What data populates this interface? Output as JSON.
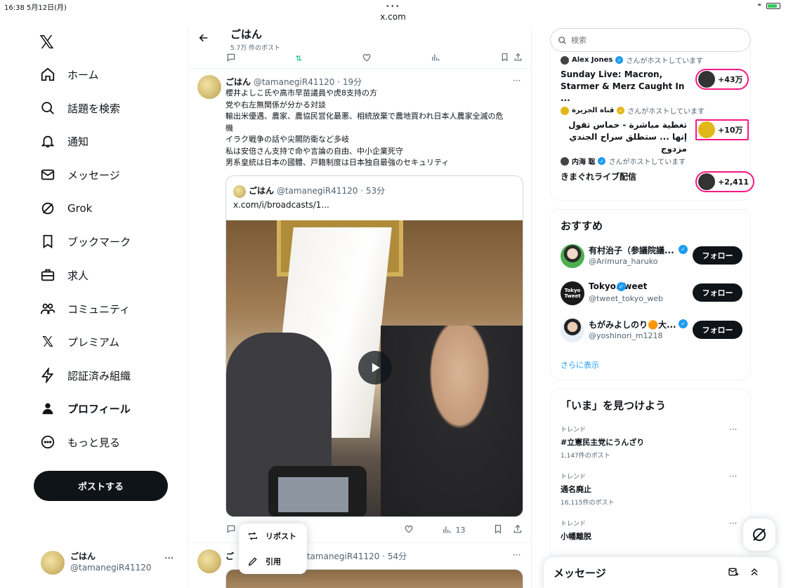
{
  "status_bar": {
    "time": "16:38",
    "date": "5月12日(月)",
    "url": "x.com",
    "dots": "•••"
  },
  "nav": {
    "items": [
      {
        "label": "ホーム",
        "icon": "home-icon"
      },
      {
        "label": "話題を検索",
        "icon": "search-icon"
      },
      {
        "label": "通知",
        "icon": "bell-icon"
      },
      {
        "label": "メッセージ",
        "icon": "mail-icon"
      },
      {
        "label": "Grok",
        "icon": "grok-icon"
      },
      {
        "label": "ブックマーク",
        "icon": "bookmark-icon"
      },
      {
        "label": "求人",
        "icon": "briefcase-icon"
      },
      {
        "label": "コミュニティ",
        "icon": "community-icon"
      },
      {
        "label": "プレミアム",
        "icon": "x-premium-icon"
      },
      {
        "label": "認証済み組織",
        "icon": "lightning-icon"
      },
      {
        "label": "プロフィール",
        "icon": "profile-icon"
      },
      {
        "label": "もっと見る",
        "icon": "more-circle-icon"
      }
    ],
    "post_button": "ポストする",
    "user": {
      "name": "ごはん",
      "handle": "@tamanegiR41120",
      "more": "···"
    }
  },
  "header": {
    "title": "ごはん",
    "subtitle": "5.7万 件のポスト"
  },
  "tweet": {
    "name": "ごはん",
    "handle": "@tamanegiR41120",
    "time": "· 19分",
    "more": "···",
    "lines": [
      "櫻井よしこ氏や高市早苗議員や虎8支持の方",
      "党や右左無関係が分かる対談",
      "輸出米優遇、農家、農協民営化最悪、相続放棄で農地買われ日本人農家全滅の危",
      "機",
      "イラク戦争の話や尖閣防衛など多岐",
      "私は安倍さん支持で命や言論の自由、中小企業死守",
      "男系皇統は日本の國體、戸籍制度は日本独自最強のセキュリティ"
    ],
    "quote": {
      "name": "ごはん",
      "handle": "@tamanegiR41120",
      "time": "· 53分",
      "link": "x.com/i/broadcasts/1..."
    },
    "views": "13"
  },
  "tweet2": {
    "name": "ご",
    "handle": "@tamanegiR41120",
    "time": "· 54分",
    "more": "···"
  },
  "popup": {
    "repost": "リポスト",
    "quote": "引用"
  },
  "search": {
    "placeholder": "検索"
  },
  "spaces": [
    {
      "host": "Alex Jones",
      "suffix": "さんがホストしています",
      "title": "Sunday Live: Macron, Starmer & Merz Caught In ...",
      "count": "+43万"
    },
    {
      "host": "قناة الجزيرة",
      "suffix": "さんがホストしています",
      "title": "تغطية مباشرة - حماس تقول إنها ... ستطلق سراح الجندي مزدوج",
      "count": "+10万"
    },
    {
      "host": "内海 聡",
      "suffix": "さんがホストしています",
      "title": "きまぐれライブ配信",
      "count": "+2,411"
    }
  ],
  "recommend": {
    "title": "おすすめ",
    "users": [
      {
        "name": "有村治子（参議院議...",
        "handle": "@Arimura_haruko",
        "follow": "フォロー"
      },
      {
        "name": "Tokyo.Tweet",
        "handle": "@tweet_tokyo_web",
        "follow": "フォロー",
        "avatar_text": "Tokyo Tweet"
      },
      {
        "name": "もがみよしのり🟠大...",
        "handle": "@yoshinori_m1218",
        "follow": "フォロー"
      }
    ],
    "show_more": "さらに表示"
  },
  "trends": {
    "title": "「いま」を見つけよう",
    "items": [
      {
        "label": "トレンド",
        "topic": "#立憲民主党にうんざり",
        "count": "1,147件のポスト"
      },
      {
        "label": "トレンド",
        "topic": "通名廃止",
        "count": "16,115件のポスト"
      },
      {
        "label": "トレンド",
        "topic": "小幡離脱",
        "count": ""
      }
    ]
  },
  "messages_drawer": {
    "title": "メッセージ"
  },
  "colors": {
    "accent": "#1d9bf0",
    "pink": "#f91880",
    "dark": "#0f1419",
    "muted": "#536471"
  }
}
